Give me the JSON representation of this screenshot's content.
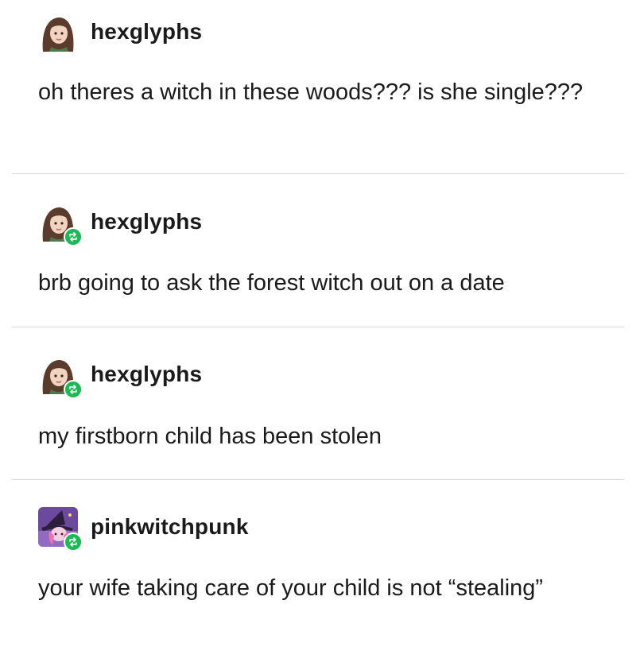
{
  "posts": [
    {
      "username": "hexglyphs",
      "text": "oh theres a witch in these woods??? is she single???",
      "reblogged": false,
      "avatar_icon": "brown-haired-girl-avatar-icon"
    },
    {
      "username": "hexglyphs",
      "text": "brb going to ask the forest witch out on a date",
      "reblogged": true,
      "avatar_icon": "brown-haired-girl-avatar-icon"
    },
    {
      "username": "hexglyphs",
      "text": "my firstborn child has been stolen",
      "reblogged": true,
      "avatar_icon": "brown-haired-girl-avatar-icon"
    },
    {
      "username": "pinkwitchpunk",
      "text": "your wife taking care of your child is not “stealing”",
      "reblogged": true,
      "avatar_icon": "pink-witch-avatar-icon"
    }
  ],
  "colors": {
    "reblog_badge": "#1db954",
    "divider": "#d9d9d9",
    "text": "#1a1a1a"
  }
}
